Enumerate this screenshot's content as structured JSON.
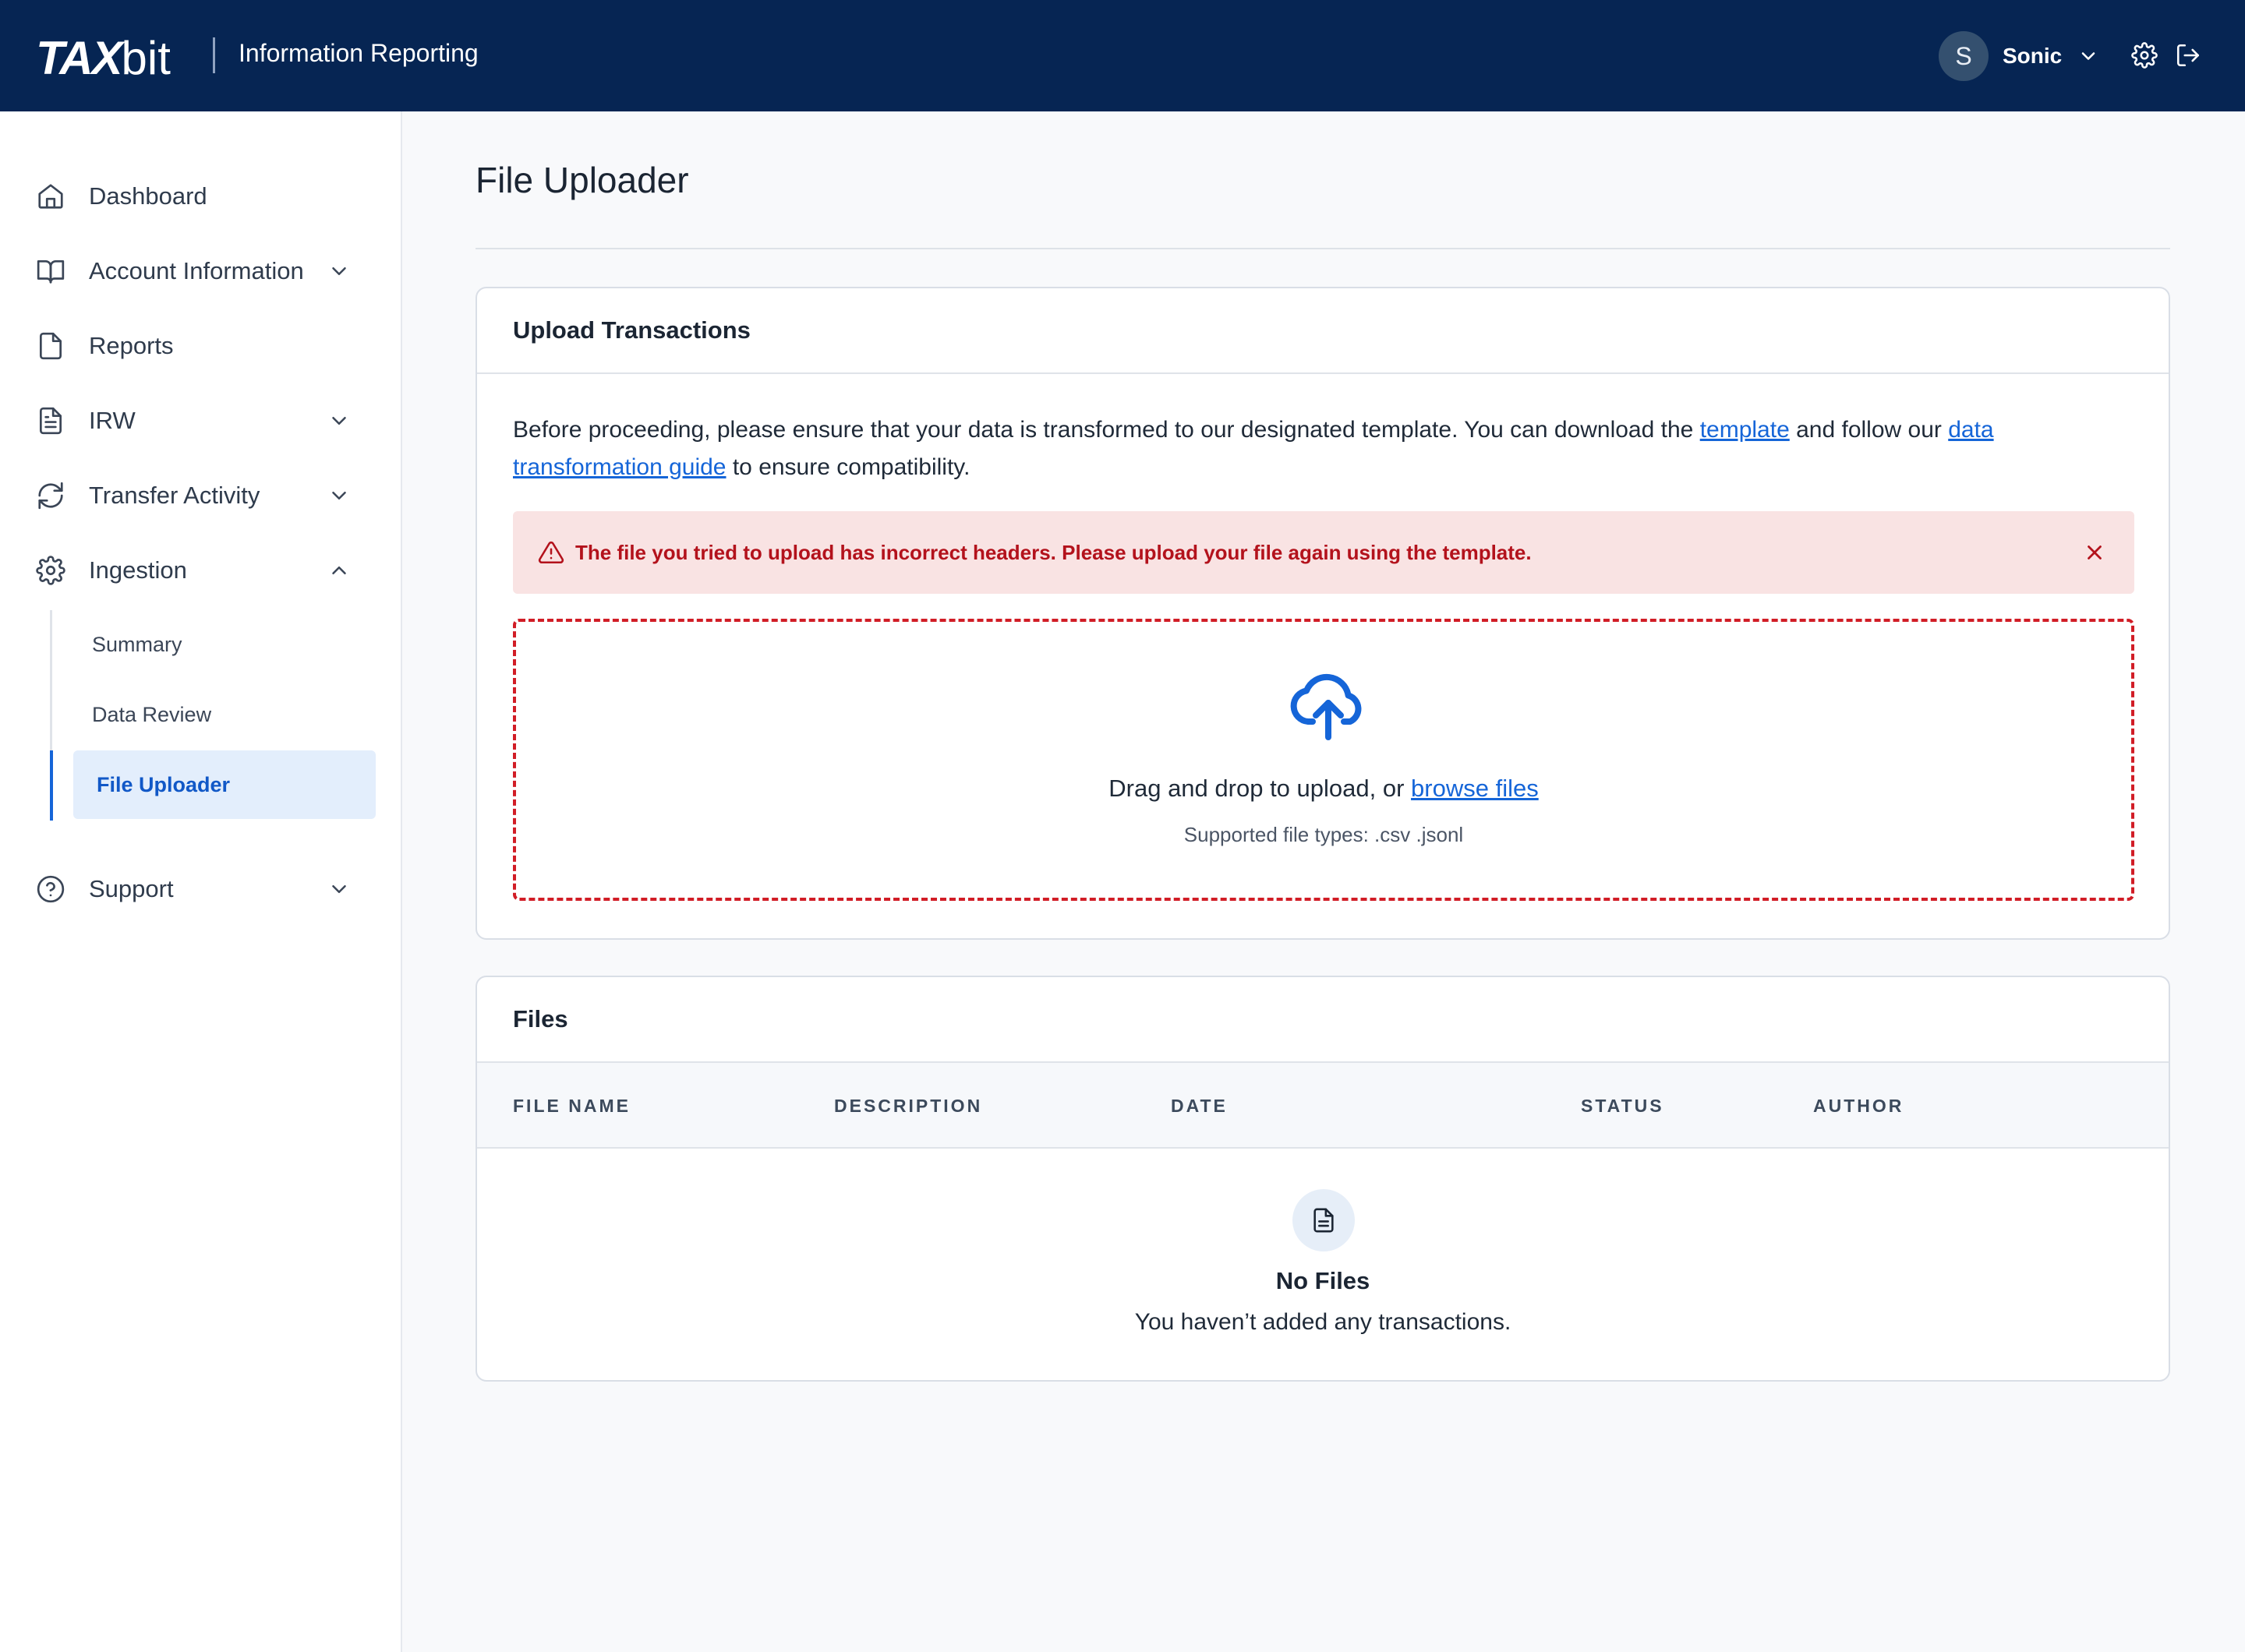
{
  "header": {
    "logo_bold": "TAX",
    "logo_light": "bit",
    "app_name": "Information Reporting",
    "user": {
      "initial": "S",
      "name": "Sonic"
    },
    "icons": [
      "gear-icon",
      "logout-icon"
    ]
  },
  "sidebar": {
    "items": [
      {
        "label": "Dashboard",
        "icon": "home-icon"
      },
      {
        "label": "Account Information",
        "icon": "book-icon",
        "expandable": true
      },
      {
        "label": "Reports",
        "icon": "file-icon"
      },
      {
        "label": "IRW",
        "icon": "document-lines-icon",
        "expandable": true
      },
      {
        "label": "Transfer Activity",
        "icon": "refresh-icon",
        "expandable": true
      },
      {
        "label": "Ingestion",
        "icon": "gear-icon",
        "expandable": true,
        "expanded": true
      },
      {
        "label": "Support",
        "icon": "help-circle-icon",
        "expandable": true
      }
    ],
    "ingestion_sub": [
      {
        "label": "Summary"
      },
      {
        "label": "Data Review"
      },
      {
        "label": "File Uploader",
        "active": true
      }
    ]
  },
  "main": {
    "title": "File Uploader",
    "upload_card": {
      "title": "Upload Transactions",
      "intro_before": "Before proceeding, please ensure that your data is transformed to our designated template. You can download the ",
      "intro_link1": "template",
      "intro_middle": " and follow our ",
      "intro_link2": "data transformation guide",
      "intro_after": " to ensure compatibility.",
      "alert": "The file you tried to upload has incorrect headers. Please upload your file again using the template.",
      "drop_text": "Drag and drop to upload, or ",
      "drop_link": "browse files",
      "supported": "Supported file types: .csv .jsonl"
    },
    "files_card": {
      "title": "Files",
      "columns": [
        "FILE NAME",
        "DESCRIPTION",
        "DATE",
        "STATUS",
        "AUTHOR"
      ],
      "empty_title": "No Files",
      "empty_sub": "You haven’t added any transactions."
    }
  },
  "colors": {
    "topbar": "#062553",
    "accent": "#1565d8",
    "error": "#b3121c",
    "error_bg": "#f9e3e3"
  }
}
